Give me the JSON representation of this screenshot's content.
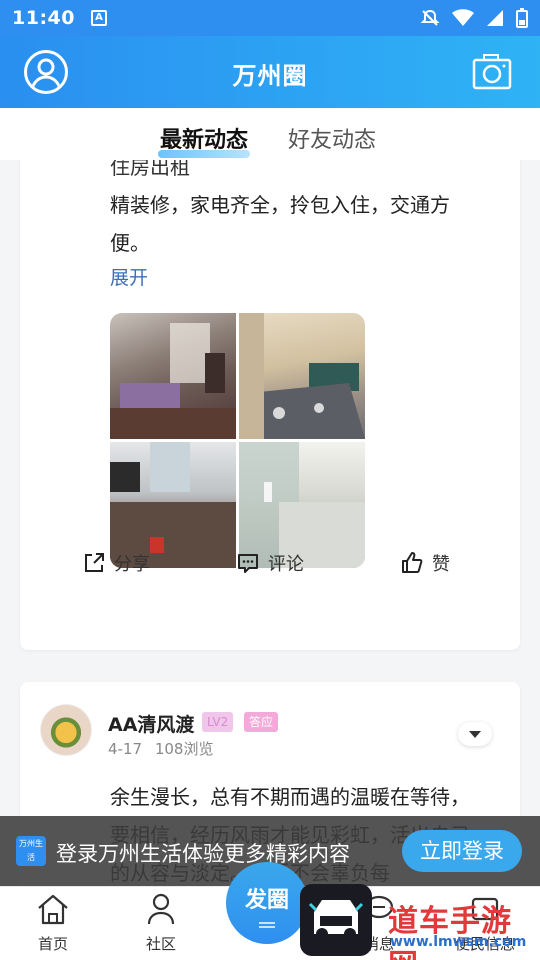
{
  "status_bar": {
    "time": "11:40",
    "notif_glyph": "A"
  },
  "header": {
    "title": "万州圈"
  },
  "tabs": [
    {
      "label": "最新动态"
    },
    {
      "label": "好友动态"
    }
  ],
  "post1": {
    "lines": [
      "住房出租",
      " 精装修，家电齐全，拎包入住，交通方",
      "便。"
    ],
    "expand_label": "展开",
    "actions": {
      "share": "分享",
      "comment": "评论",
      "like": "赞"
    }
  },
  "post2": {
    "author": "AA清风渡",
    "badge_level": "LV2",
    "badge_role": "答应",
    "date": "4-17",
    "views": "108浏览",
    "text": "余生漫长，总有不期而遇的温暖在等待，要相信，经历风雨才能见彩虹，活出自己的从容与淡定。生活不会辜负每"
  },
  "login_banner": {
    "logo_text": "万州生活",
    "text": "登录万州生活体验更多精彩内容",
    "button": "立即登录"
  },
  "bottom_nav": {
    "home": "首页",
    "community": "社区",
    "post": "发圈",
    "messages": "消息",
    "services": "便民信息"
  },
  "watermark": {
    "title": "道车手游网",
    "url": "www.lmwsm.com"
  },
  "colors": {
    "brand": "#2f8ff0",
    "link": "#3d6fb3",
    "banner_bg": "#3c3c3c"
  }
}
